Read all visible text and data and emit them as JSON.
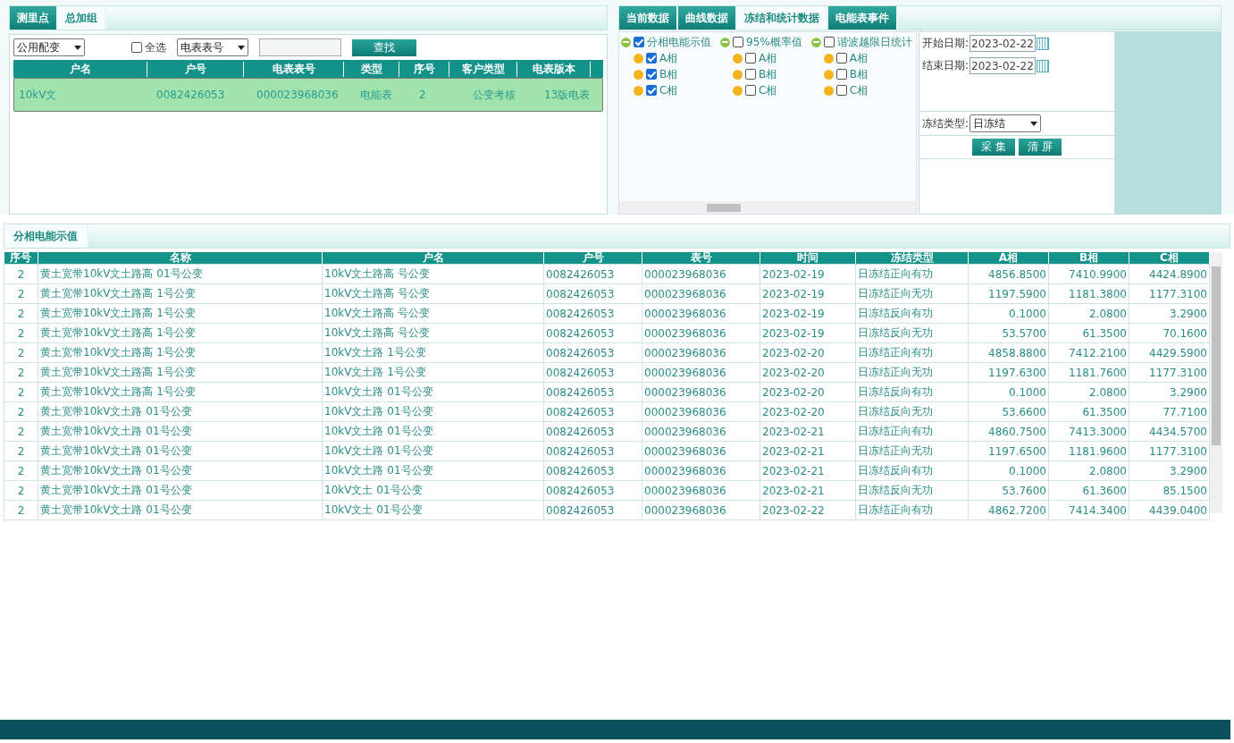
{
  "left_panel": {
    "tabs": [
      {
        "label": "测里点",
        "selected": false
      },
      {
        "label": "总加组",
        "selected": true
      }
    ],
    "filters": {
      "category": "公用配变",
      "select_all": {
        "label": "全选",
        "checked": false
      },
      "search_type": "电表表号",
      "search_button": "查找"
    },
    "table": {
      "columns": [
        "户名",
        "户号",
        "电表表号",
        "类型",
        "序号",
        "客户类型",
        "电表版本"
      ],
      "rows": [
        {
          "cells": [
            "10kV文",
            "0082426053",
            "000023968036",
            "电能表",
            "2",
            "公变考核",
            "13版电表"
          ],
          "selected": true
        }
      ]
    }
  },
  "right_panel": {
    "tabs": [
      {
        "label": "当前数据",
        "selected": false
      },
      {
        "label": "曲线数据",
        "selected": false
      },
      {
        "label": "冻结和统计数据",
        "selected": true
      },
      {
        "label": "电能表事件",
        "selected": false
      }
    ],
    "tree": [
      {
        "label": "分相电能示值",
        "checked": true,
        "children": [
          {
            "label": "A相",
            "checked": true
          },
          {
            "label": "B相",
            "checked": true
          },
          {
            "label": "C相",
            "checked": true
          }
        ]
      },
      {
        "label": "95%概率值",
        "checked": false,
        "children": [
          {
            "label": "A相",
            "checked": false
          },
          {
            "label": "B相",
            "checked": false
          },
          {
            "label": "C相",
            "checked": false
          }
        ]
      },
      {
        "label": "谐波越限日统计",
        "checked": false,
        "children": [
          {
            "label": "A相",
            "checked": false
          },
          {
            "label": "B相",
            "checked": false
          },
          {
            "label": "C相",
            "checked": false
          }
        ]
      }
    ],
    "start_date": {
      "label": "开始日期:",
      "value": "2023-02-22"
    },
    "end_date": {
      "label": "结束日期:",
      "value": "2023-02-22"
    },
    "freeze_type": {
      "label": "冻结类型:",
      "value": "日冻结"
    },
    "buttons": [
      "采 集",
      "清 屏"
    ]
  },
  "result": {
    "tab": "分相电能示值",
    "columns": [
      "序号",
      "名称",
      "户名",
      "户号",
      "表号",
      "时间",
      "冻结类型",
      "A相",
      "B相",
      "C相"
    ],
    "rows": [
      [
        "2",
        "黄土宽带10kV文土路高 01号公变",
        "10kV文土路高 号公变",
        "0082426053",
        "000023968036",
        "2023-02-19",
        "日冻结正向有功",
        "4856.8500",
        "7410.9900",
        "4424.8900"
      ],
      [
        "2",
        "黄土宽带10kV文土路高 1号公变",
        "10kV文土路高 号公变",
        "0082426053",
        "000023968036",
        "2023-02-19",
        "日冻结正向无功",
        "1197.5900",
        "1181.3800",
        "1177.3100"
      ],
      [
        "2",
        "黄土宽带10kV文土路高 1号公变",
        "10kV文土路高 号公变",
        "0082426053",
        "000023968036",
        "2023-02-19",
        "日冻结反向有功",
        "0.1000",
        "2.0800",
        "3.2900"
      ],
      [
        "2",
        "黄土宽带10kV文土路高 1号公变",
        "10kV文土路高 号公变",
        "0082426053",
        "000023968036",
        "2023-02-19",
        "日冻结反向无功",
        "53.5700",
        "61.3500",
        "70.1600"
      ],
      [
        "2",
        "黄土宽带10kV文土路高 1号公变",
        "10kV文土路 1号公变",
        "0082426053",
        "000023968036",
        "2023-02-20",
        "日冻结正向有功",
        "4858.8800",
        "7412.2100",
        "4429.5900"
      ],
      [
        "2",
        "黄土宽带10kV文土路高 1号公变",
        "10kV文土路 1号公变",
        "0082426053",
        "000023968036",
        "2023-02-20",
        "日冻结正向无功",
        "1197.6300",
        "1181.7600",
        "1177.3100"
      ],
      [
        "2",
        "黄土宽带10kV文土路高 1号公变",
        "10kV文土路 01号公变",
        "0082426053",
        "000023968036",
        "2023-02-20",
        "日冻结反向有功",
        "0.1000",
        "2.0800",
        "3.2900"
      ],
      [
        "2",
        "黄土宽带10kV文土路 01号公变",
        "10kV文土路 01号公变",
        "0082426053",
        "000023968036",
        "2023-02-20",
        "日冻结反向无功",
        "53.6600",
        "61.3500",
        "77.7100"
      ],
      [
        "2",
        "黄土宽带10kV文土路 01号公变",
        "10kV文土路 01号公变",
        "0082426053",
        "000023968036",
        "2023-02-21",
        "日冻结正向有功",
        "4860.7500",
        "7413.3000",
        "4434.5700"
      ],
      [
        "2",
        "黄土宽带10kV文土路 01号公变",
        "10kV文土路 01号公变",
        "0082426053",
        "000023968036",
        "2023-02-21",
        "日冻结正向无功",
        "1197.6500",
        "1181.9600",
        "1177.3100"
      ],
      [
        "2",
        "黄土宽带10kV文土路 01号公变",
        "10kV文土路 01号公变",
        "0082426053",
        "000023968036",
        "2023-02-21",
        "日冻结反向有功",
        "0.1000",
        "2.0800",
        "3.2900"
      ],
      [
        "2",
        "黄土宽带10kV文土路 01号公变",
        "10kV文土 01号公变",
        "0082426053",
        "000023968036",
        "2023-02-21",
        "日冻结反向无功",
        "53.7600",
        "61.3600",
        "85.1500"
      ],
      [
        "2",
        "黄土宽带10kV文土路 01号公变",
        "10kV文土 01号公变",
        "0082426053",
        "000023968036",
        "2023-02-22",
        "日冻结正向有功",
        "4862.7200",
        "7414.3400",
        "4439.0400"
      ]
    ]
  }
}
